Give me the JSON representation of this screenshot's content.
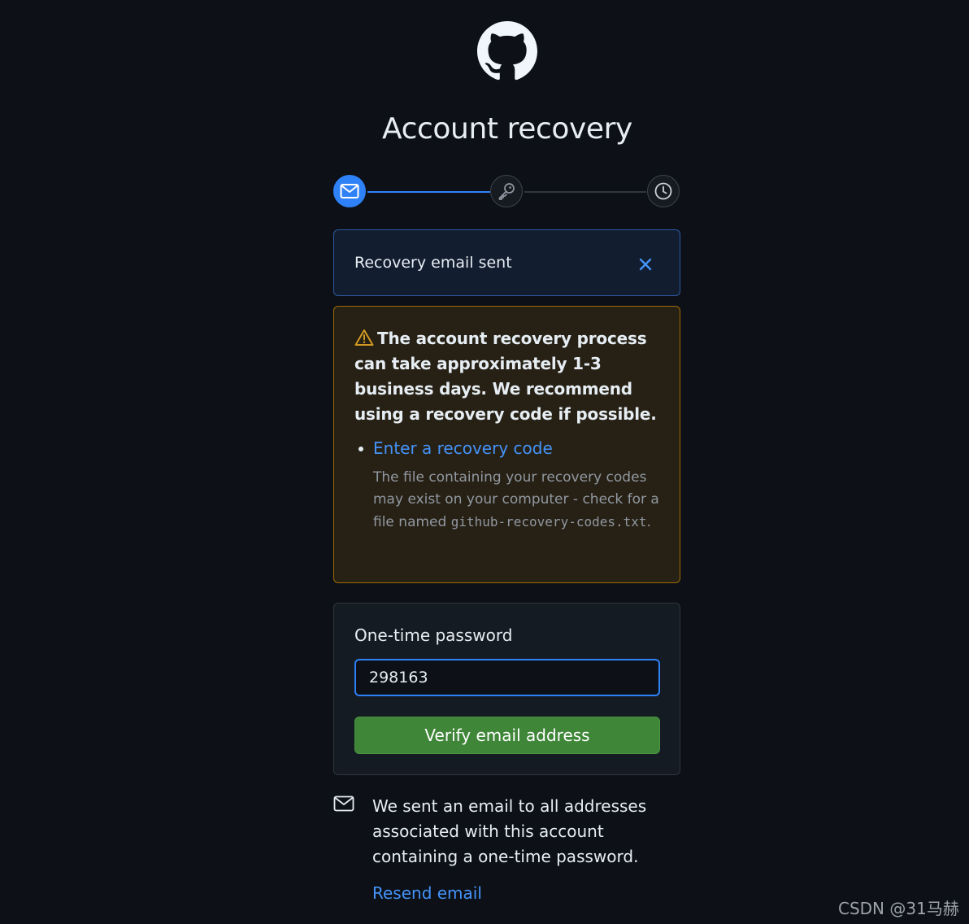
{
  "page": {
    "title": "Account recovery"
  },
  "stepper": {
    "steps": [
      {
        "icon": "mail-icon",
        "state": "active"
      },
      {
        "icon": "key-icon",
        "state": "pending"
      },
      {
        "icon": "clock-icon",
        "state": "pending"
      }
    ]
  },
  "flash": {
    "message": "Recovery email sent",
    "close_icon": "close-icon"
  },
  "warning": {
    "heading": "The account recovery process can take approximately 1-3 business days. We recommend using a recovery code if possible.",
    "link_label": "Enter a recovery code",
    "hint_prefix": "The file containing your recovery codes may exist on your computer - check for a file named",
    "hint_filename": "github-recovery-codes.txt",
    "hint_suffix": "."
  },
  "otp": {
    "label": "One-time password",
    "value": "298163",
    "button_label": "Verify email address"
  },
  "info": {
    "icon": "mail-icon",
    "text": "We sent an email to all addresses associated with this account containing a one-time password.",
    "resend_label": "Resend email"
  },
  "watermark": "CSDN @31马赫",
  "colors": {
    "background": "#0d1117",
    "accent": "#2f81f7",
    "link": "#4493f8",
    "success_button": "#3f8638",
    "warning_border": "#9e6a03"
  }
}
